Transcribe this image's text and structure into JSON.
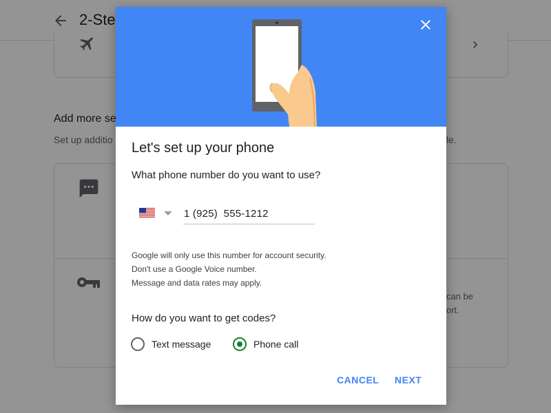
{
  "background_page": {
    "title": "2-Ste",
    "section_title": "Add more se",
    "section_subtitle": "Set up additio",
    "section_subtitle_end": "le.",
    "key_card_text_1": "can be",
    "key_card_text_2": "ort."
  },
  "dialog": {
    "title": "Let's set up your phone",
    "phone_question": "What phone number do you want to use?",
    "country": {
      "selected": "United States",
      "flag": "us-flag-icon"
    },
    "phone_number": "1 (925)  555-1212",
    "notes": [
      "Google will only use this number for account security.",
      "Don't use a Google Voice number.",
      "Message and data rates may apply."
    ],
    "codes_question": "How do you want to get codes?",
    "options": [
      {
        "label": "Text message",
        "selected": false
      },
      {
        "label": "Phone call",
        "selected": true
      }
    ],
    "cancel_label": "CANCEL",
    "next_label": "NEXT"
  },
  "colors": {
    "accent": "#4285f4",
    "radio_selected": "#188038",
    "hero_background": "#4285f4"
  }
}
